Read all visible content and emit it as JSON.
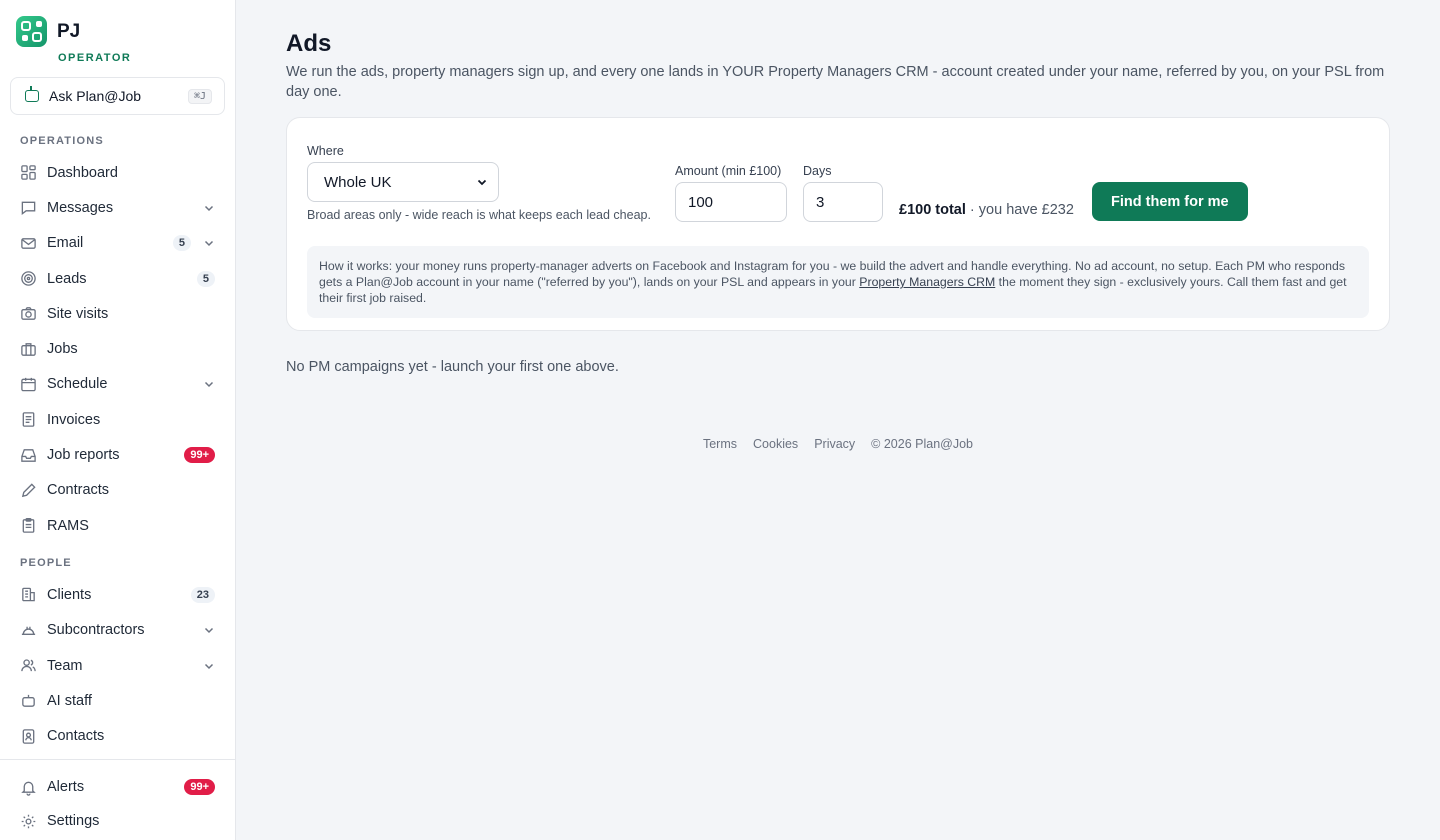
{
  "brand": {
    "name": "PJ",
    "role": "OPERATOR"
  },
  "ask": {
    "label": "Ask Plan@Job",
    "shortcut": "⌘J"
  },
  "sections": {
    "operations": "OPERATIONS",
    "people": "PEOPLE"
  },
  "nav": {
    "dashboard": "Dashboard",
    "messages": "Messages",
    "email": "Email",
    "email_count": "5",
    "leads": "Leads",
    "leads_count": "5",
    "site_visits": "Site visits",
    "jobs": "Jobs",
    "schedule": "Schedule",
    "invoices": "Invoices",
    "job_reports": "Job reports",
    "job_reports_badge": "99+",
    "contracts": "Contracts",
    "rams": "RAMS",
    "clients": "Clients",
    "clients_count": "23",
    "subcontractors": "Subcontractors",
    "team": "Team",
    "ai_staff": "AI staff",
    "contacts": "Contacts",
    "alerts": "Alerts",
    "alerts_badge": "99+",
    "settings": "Settings"
  },
  "page": {
    "title": "Ads",
    "subtitle": "We run the ads, property managers sign up, and every one lands in YOUR Property Managers CRM - account created under your name, referred by you, on your PSL from day one."
  },
  "form": {
    "where_label": "Where",
    "where_value": "Whole UK",
    "where_hint": "Broad areas only - wide reach is what keeps each lead cheap.",
    "amount_label": "Amount (min £100)",
    "amount_value": "100",
    "days_label": "Days",
    "days_value": "3",
    "total_strong": "£100 total",
    "total_rest": " · you have £232",
    "cta": "Find them for me"
  },
  "info": {
    "before": "How it works: your money runs property-manager adverts on Facebook and Instagram for you - we build the advert and handle everything. No ad account, no setup. Each PM who responds gets a Plan@Job account in your name (\"referred by you\"), lands on your PSL and appears in your ",
    "link": "Property Managers CRM",
    "after": " the moment they sign - exclusively yours. Call them fast and get their first job raised."
  },
  "empty": "No PM campaigns yet - launch your first one above.",
  "footer": {
    "terms": "Terms",
    "cookies": "Cookies",
    "privacy": "Privacy",
    "copyright": "© 2026 Plan@Job"
  }
}
